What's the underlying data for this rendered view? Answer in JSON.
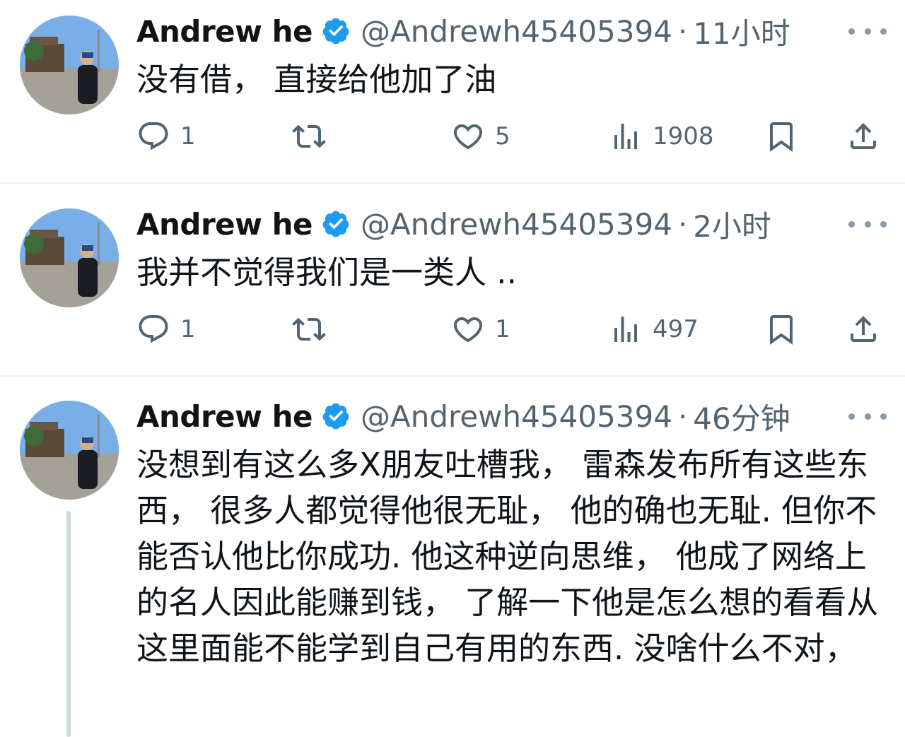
{
  "tweets": [
    {
      "author": "Andrew he",
      "handle": "@Andrewh45405394",
      "separator": "·",
      "time": "11小时",
      "text": "没有借， 直接给他加了油",
      "replies": "1",
      "retweets": "",
      "likes": "5",
      "views": "1908"
    },
    {
      "author": "Andrew he",
      "handle": "@Andrewh45405394",
      "separator": "·",
      "time": "2小时",
      "text": "我并不觉得我们是一类人 ..",
      "replies": "1",
      "retweets": "",
      "likes": "1",
      "views": "497"
    },
    {
      "author": "Andrew he",
      "handle": "@Andrewh45405394",
      "separator": "·",
      "time": "46分钟",
      "text": "没想到有这么多X朋友吐槽我， 雷森发布所有这些东西， 很多人都觉得他很无耻， 他的确也无耻. 但你不能否认他比你成功. 他这种逆向思维， 他成了网络上的名人因此能赚到钱， 了解一下他是怎么想的看看从这里面能不能学到自己有用的东西. 没啥什么不对，"
    }
  ],
  "colors": {
    "verified": "#1d9bf0",
    "text": "#0f1419",
    "secondary": "#536471"
  },
  "icons": [
    "verified-badge-icon",
    "more-icon",
    "reply-icon",
    "retweet-icon",
    "like-icon",
    "views-icon",
    "bookmark-icon",
    "share-icon"
  ]
}
